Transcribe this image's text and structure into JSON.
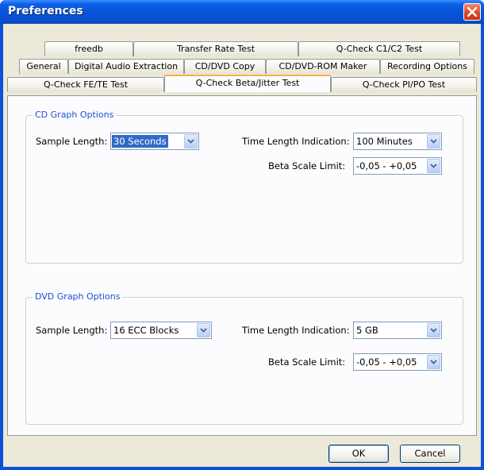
{
  "window": {
    "title": "Preferences"
  },
  "tabs": {
    "row1": [
      "freedb",
      "Transfer Rate Test",
      "Q-Check C1/C2 Test"
    ],
    "row2": [
      "General",
      "Digital Audio Extraction",
      "CD/DVD Copy",
      "CD/DVD-ROM Maker",
      "Recording Options"
    ],
    "row3": [
      "Q-Check FE/TE Test",
      "Q-Check Beta/Jitter Test",
      "Q-Check PI/PO Test"
    ],
    "active": "Q-Check Beta/Jitter Test"
  },
  "cd_group": {
    "title": "CD Graph Options",
    "sample_length_label": "Sample Length:",
    "sample_length_value": "30 Seconds",
    "time_length_label": "Time Length Indication:",
    "time_length_value": "100 Minutes",
    "beta_scale_label": "Beta Scale Limit:",
    "beta_scale_value": "-0,05  -  +0,05"
  },
  "dvd_group": {
    "title": "DVD Graph Options",
    "sample_length_label": "Sample Length:",
    "sample_length_value": "16 ECC Blocks",
    "time_length_label": "Time Length Indication:",
    "time_length_value": "5 GB",
    "beta_scale_label": "Beta Scale Limit:",
    "beta_scale_value": "-0,05  -  +0,05"
  },
  "buttons": {
    "ok": "OK",
    "cancel": "Cancel"
  },
  "colors": {
    "title_bar": "#0653d8",
    "group_label": "#1f4fd1",
    "selection": "#316ac5",
    "active_tab_accent": "#f2b542"
  }
}
